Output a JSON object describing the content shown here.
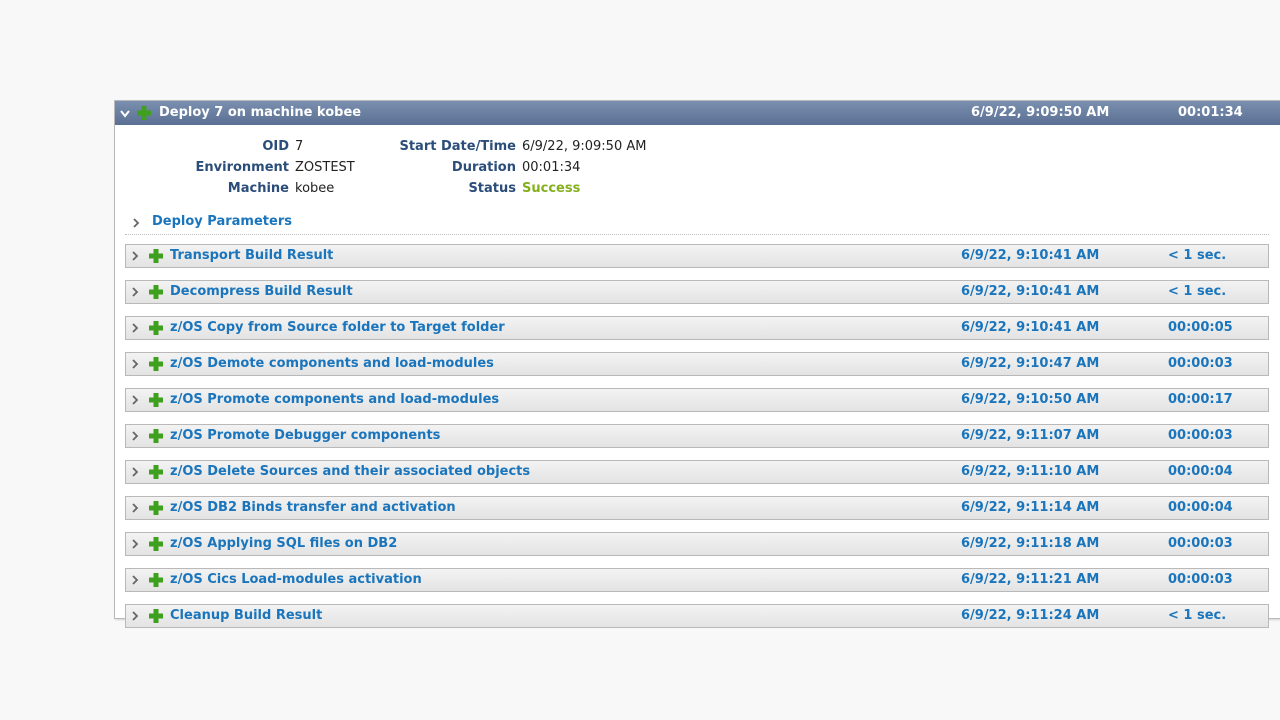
{
  "deploy": {
    "title": "Deploy 7 on machine kobee",
    "date": "6/9/22, 9:09:50 AM",
    "duration": "00:01:34"
  },
  "details": {
    "oid_label": "OID",
    "oid": "7",
    "environment_label": "Environment",
    "environment": "ZOSTEST",
    "machine_label": "Machine",
    "machine": "kobee",
    "start_label": "Start Date/Time",
    "start": "6/9/22, 9:09:50 AM",
    "duration_label": "Duration",
    "duration": "00:01:34",
    "status_label": "Status",
    "status": "Success"
  },
  "parameters_label": "Deploy Parameters",
  "steps": [
    {
      "name": "Transport Build Result",
      "date": "6/9/22, 9:10:41 AM",
      "duration": "< 1 sec."
    },
    {
      "name": "Decompress Build Result",
      "date": "6/9/22, 9:10:41 AM",
      "duration": "< 1 sec."
    },
    {
      "name": "z/OS Copy from Source folder to Target folder",
      "date": "6/9/22, 9:10:41 AM",
      "duration": "00:00:05"
    },
    {
      "name": "z/OS Demote components and load-modules",
      "date": "6/9/22, 9:10:47 AM",
      "duration": "00:00:03"
    },
    {
      "name": "z/OS Promote components and load-modules",
      "date": "6/9/22, 9:10:50 AM",
      "duration": "00:00:17"
    },
    {
      "name": "z/OS Promote Debugger components",
      "date": "6/9/22, 9:11:07 AM",
      "duration": "00:00:03"
    },
    {
      "name": "z/OS Delete Sources and their associated objects",
      "date": "6/9/22, 9:11:10 AM",
      "duration": "00:00:04"
    },
    {
      "name": "z/OS DB2 Binds transfer and activation",
      "date": "6/9/22, 9:11:14 AM",
      "duration": "00:00:04"
    },
    {
      "name": "z/OS Applying SQL files on DB2",
      "date": "6/9/22, 9:11:18 AM",
      "duration": "00:00:03"
    },
    {
      "name": "z/OS Cics Load-modules activation",
      "date": "6/9/22, 9:11:21 AM",
      "duration": "00:00:03"
    },
    {
      "name": "Cleanup Build Result",
      "date": "6/9/22, 9:11:24 AM",
      "duration": "< 1 sec."
    }
  ],
  "colors": {
    "link": "#1a75bc",
    "label": "#2b4d7a",
    "success": "#85b01e",
    "plus": "#3f9f1f",
    "header": "#5a6f92"
  },
  "icons": {
    "collapse": "chevron-down-icon",
    "expand": "chevron-right-icon",
    "status": "plus-icon"
  }
}
